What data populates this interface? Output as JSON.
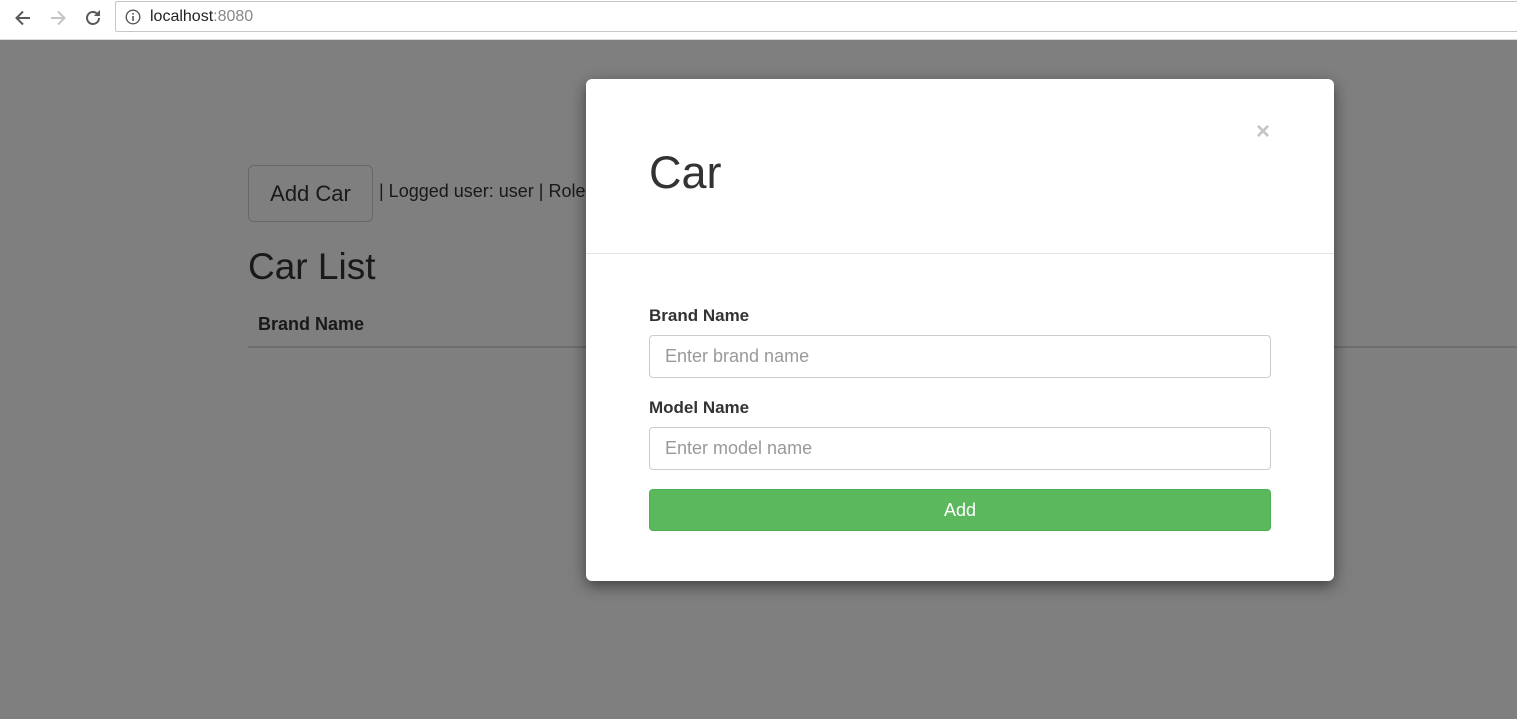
{
  "browser": {
    "url_host": "localhost",
    "url_port": ":8080"
  },
  "page": {
    "add_car_label": "Add Car",
    "user_info": "| Logged user: user | Roles",
    "title": "Car List",
    "table_headers": [
      "Brand Name"
    ]
  },
  "modal": {
    "title": "Car",
    "close_label": "×",
    "brand_label": "Brand Name",
    "brand_placeholder": "Enter brand name",
    "brand_value": "",
    "model_label": "Model Name",
    "model_placeholder": "Enter model name",
    "model_value": "",
    "submit_label": "Add"
  },
  "colors": {
    "submit_button": "#5cb85c",
    "backdrop": "rgba(0,0,0,0.5)"
  },
  "icons": {
    "back": "arrow-left-icon",
    "forward": "arrow-right-icon",
    "reload": "reload-icon",
    "info": "info-icon"
  }
}
